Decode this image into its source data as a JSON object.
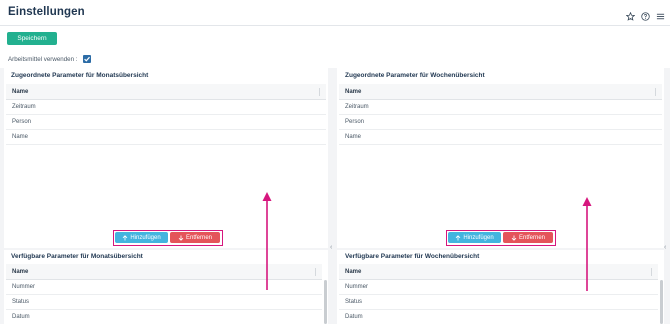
{
  "header": {
    "title": "Einstellungen",
    "icons": [
      "star-icon",
      "help-icon",
      "menu-icon"
    ]
  },
  "toolbar": {
    "save_label": "Speichern"
  },
  "settings": {
    "use_equipment_label": "Arbeitsmittel verwenden :",
    "use_equipment_checked": true
  },
  "month": {
    "assigned_title": "Zugeordnete Parameter für Monatsübersicht",
    "available_title": "Verfügbare Parameter für Monatsübersicht",
    "column_name": "Name",
    "assigned_rows": [
      "Zeitraum",
      "Person",
      "Name"
    ],
    "available_rows": [
      "Nummer",
      "Status",
      "Datum"
    ],
    "add_label": "Hinzufügen",
    "remove_label": "Entfernen"
  },
  "week": {
    "assigned_title": "Zugeordnete Parameter für Wochenübersicht",
    "available_title": "Verfügbare Parameter für Wochenübersicht",
    "column_name": "Name",
    "assigned_rows": [
      "Zeitraum",
      "Person",
      "Name"
    ],
    "available_rows": [
      "Nummer",
      "Status",
      "Datum"
    ],
    "add_label": "Hinzufügen",
    "remove_label": "Entfernen"
  },
  "colors": {
    "accent": "#22b08f",
    "add": "#43b4df",
    "remove": "#e4545a",
    "highlight": "#d6177e"
  }
}
